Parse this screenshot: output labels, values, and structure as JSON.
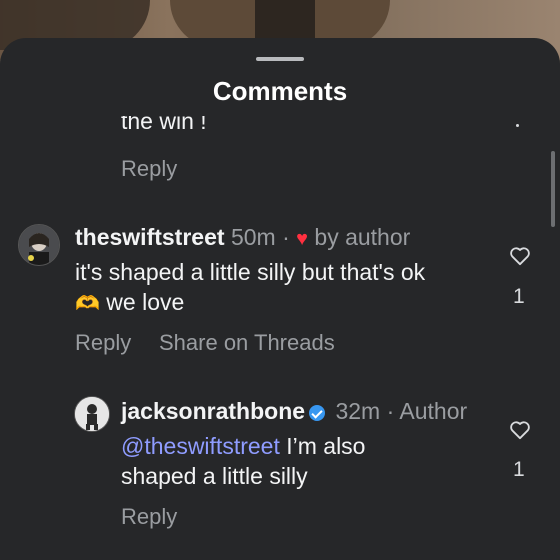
{
  "sheet": {
    "title": "Comments"
  },
  "comments": [
    {
      "partial_text": "the win !",
      "reply_label": "Reply"
    },
    {
      "username": "theswiftstreet",
      "time": "50m",
      "separator": "·",
      "liked_by": "by author",
      "text_line1": "it's shaped a little silly but that's ok",
      "emoji": "🫶",
      "text_line2": "we love",
      "reply_label": "Reply",
      "share_label": "Share on Threads",
      "like_count": "1"
    },
    {
      "username": "jacksonrathbone",
      "time": "32m",
      "separator": "·",
      "role": "Author",
      "mention": "@theswiftstreet",
      "text_line1_rest": " I’m also",
      "text_line2": "shaped a little silly",
      "reply_label": "Reply",
      "like_count": "1"
    }
  ],
  "colors": {
    "sheet_bg": "#262729",
    "text": "#f3f4f5",
    "muted": "#9a9da1",
    "mention": "#8f9cff",
    "heart_red": "#ff3040",
    "verified_blue": "#3897f0"
  },
  "icons": [
    "drag-handle-icon",
    "red-heart-icon",
    "heart-outline-icon",
    "verified-badge-icon",
    "more-options-icon"
  ]
}
